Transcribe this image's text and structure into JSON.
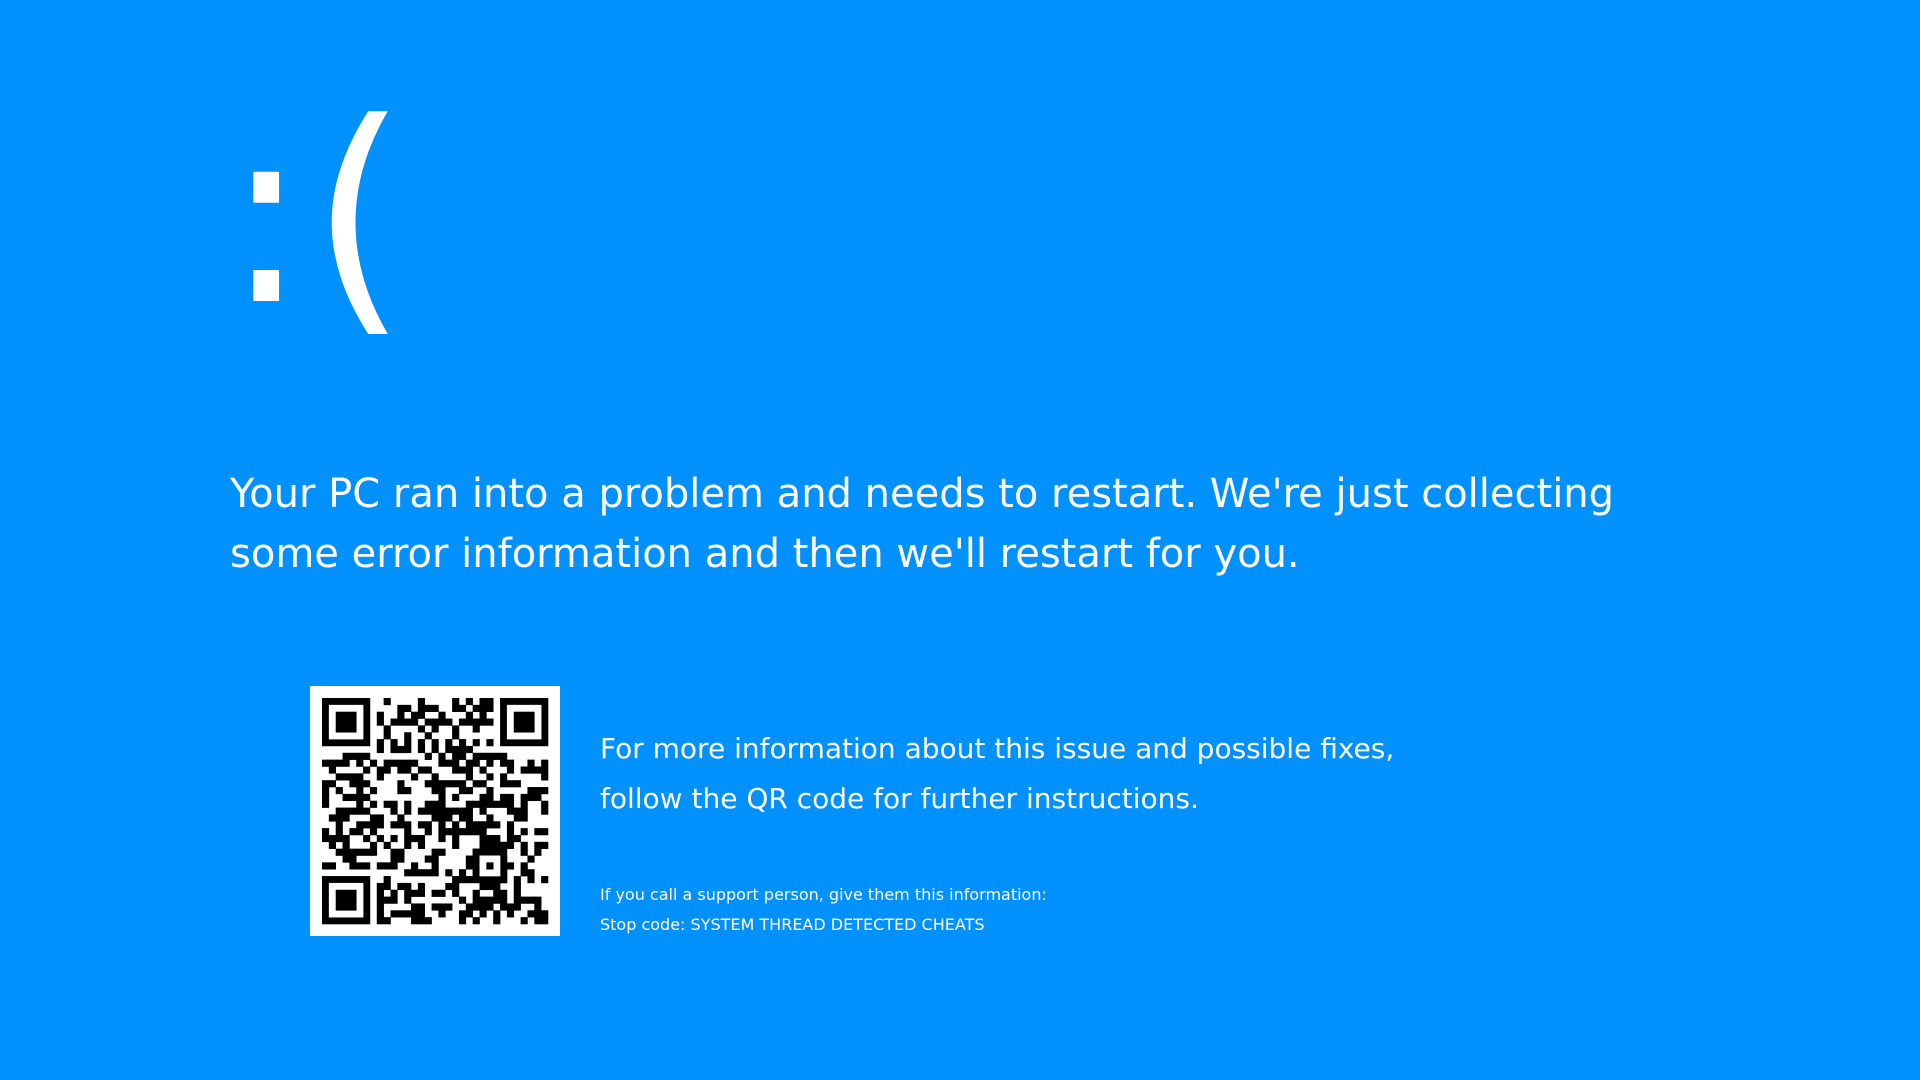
{
  "screen": {
    "background_color": "#0091ff",
    "text_color": "#ffffff"
  },
  "face": {
    "text": ":("
  },
  "message": {
    "line1": "Your PC ran into a problem and needs to restart. We're just collecting",
    "line2": "some error information and then we'll restart for you."
  },
  "more_info": {
    "line1": "For more information about this issue and possible fixes,",
    "line2": "follow the QR code for further instructions."
  },
  "support": {
    "call_text": "If you call a support person, give them this information:",
    "stop_code_label": "Stop code:",
    "stop_code": "SYSTEM THREAD DETECTED CHEATS"
  },
  "qr": {
    "icon": "qr-code-icon",
    "foreground": "#000000",
    "background": "#ffffff"
  }
}
